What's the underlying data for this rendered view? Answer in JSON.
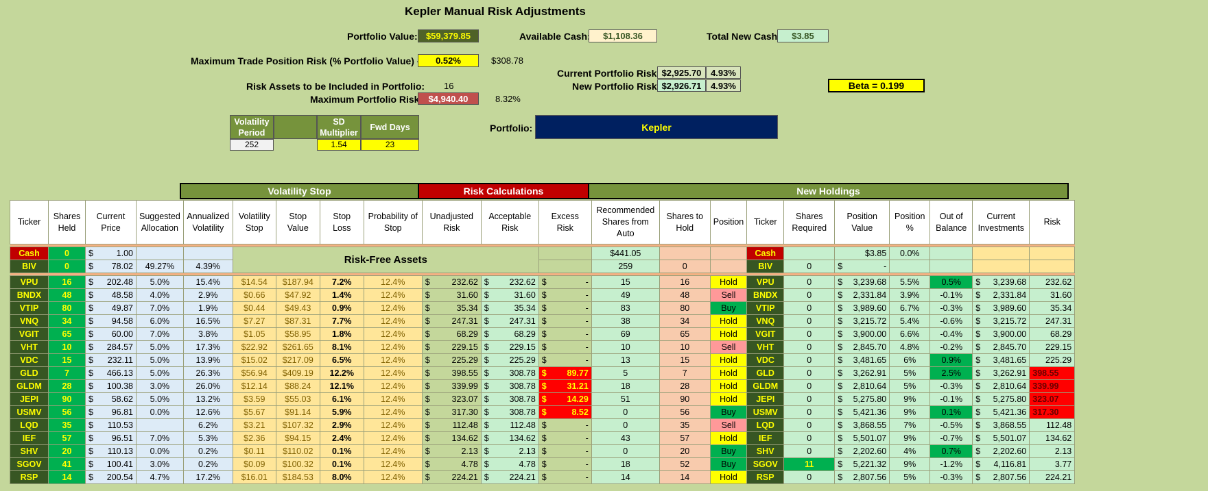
{
  "title": "Kepler Manual Risk Adjustments",
  "summary": {
    "portfolio_value_label": "Portfolio Value:",
    "portfolio_value": "$59,379.85",
    "available_cash_label": "Available Cash:",
    "available_cash": "$1,108.36",
    "total_new_cash_label": "Total New Cash:",
    "total_new_cash": "$3.85",
    "max_trade_risk_label": "Maximum Trade Position Risk (% Portfolio Value) - R:",
    "max_trade_risk_pct": "0.52%",
    "max_trade_risk_value": "$308.78",
    "current_portfolio_risk_label": "Current Portfolio Risk:",
    "current_portfolio_risk": "$2,925.70",
    "current_portfolio_risk_pct": "4.93%",
    "new_portfolio_risk_label": "New Portfolio Risk:",
    "new_portfolio_risk": "$2,926.71",
    "new_portfolio_risk_pct": "4.93%",
    "risk_assets_label": "Risk Assets to be Included in Portfolio:",
    "risk_assets": "16",
    "max_portfolio_risk_label": "Maximum Portfolio Risk:",
    "max_portfolio_risk": "$4,940.40",
    "max_portfolio_risk_pct": "8.32%",
    "beta": "Beta =  0.199",
    "portfolio_label": "Portfolio:",
    "portfolio_name": "Kepler"
  },
  "params": {
    "vol_period_label": "Volatility Period",
    "vol_period": "252",
    "sd_mult_label": "SD Multiplier",
    "sd_mult": "1.54",
    "fwd_days_label": "Fwd Days",
    "fwd_days": "23"
  },
  "bands": {
    "volatility_stop": "Volatility Stop",
    "risk_calculations": "Risk Calculations",
    "new_holdings": "New Holdings",
    "risk_free_assets": "Risk-Free Assets"
  },
  "columns": [
    "Ticker",
    "Shares Held",
    "Current Price",
    "Suggested Allocation",
    "Annualized Volatility",
    "Volatility Stop",
    "Stop Value",
    "Stop Loss",
    "Probability of Stop",
    "Unadjusted Risk",
    "Acceptable Risk",
    "Excess Risk",
    "Recommended Shares from Auto",
    "Shares to Hold",
    "Position",
    "Ticker",
    "Shares Required",
    "Position Value",
    "Position %",
    "Out of Balance",
    "Current Investments",
    "Risk"
  ],
  "cash_row": {
    "ticker": "Cash",
    "held": "0",
    "price": "1.00",
    "rec": "$441.05",
    "ticker2": "Cash",
    "posval": "$3.85",
    "pospct": "0.0%"
  },
  "biv_row": {
    "ticker": "BIV",
    "held": "0",
    "price": "78.02",
    "alloc": "49.27%",
    "vol": "4.39%",
    "rec": "259",
    "hold": "0",
    "ticker2": "BIV",
    "req": "0",
    "posval": "-"
  },
  "rows": [
    {
      "t": "VPU",
      "h": "16",
      "p": "202.48",
      "a": "5.0%",
      "v": "15.4%",
      "vs": "$14.54",
      "sv": "$187.94",
      "sl": "7.2%",
      "ps": "12.4%",
      "ur": "232.62",
      "ar": "232.62",
      "er": "-",
      "rec": "15",
      "hold": "16",
      "pos": "Hold",
      "req": "0",
      "pv": "3,239.68",
      "pp": "5.5%",
      "oob": "0.5%",
      "ci": "3,239.68",
      "risk": "232.62"
    },
    {
      "t": "BNDX",
      "h": "48",
      "p": "48.58",
      "a": "4.0%",
      "v": "2.9%",
      "vs": "$0.66",
      "sv": "$47.92",
      "sl": "1.4%",
      "ps": "12.4%",
      "ur": "31.60",
      "ar": "31.60",
      "er": "-",
      "rec": "49",
      "hold": "48",
      "pos": "Sell",
      "req": "0",
      "pv": "2,331.84",
      "pp": "3.9%",
      "oob": "-0.1%",
      "ci": "2,331.84",
      "risk": "31.60"
    },
    {
      "t": "VTIP",
      "h": "80",
      "p": "49.87",
      "a": "7.0%",
      "v": "1.9%",
      "vs": "$0.44",
      "sv": "$49.43",
      "sl": "0.9%",
      "ps": "12.4%",
      "ur": "35.34",
      "ar": "35.34",
      "er": "-",
      "rec": "83",
      "hold": "80",
      "pos": "Buy",
      "req": "0",
      "pv": "3,989.60",
      "pp": "6.7%",
      "oob": "-0.3%",
      "ci": "3,989.60",
      "risk": "35.34"
    },
    {
      "t": "VNQ",
      "h": "34",
      "p": "94.58",
      "a": "6.0%",
      "v": "16.5%",
      "vs": "$7.27",
      "sv": "$87.31",
      "sl": "7.7%",
      "ps": "12.4%",
      "ur": "247.31",
      "ar": "247.31",
      "er": "-",
      "rec": "38",
      "hold": "34",
      "pos": "Hold",
      "req": "0",
      "pv": "3,215.72",
      "pp": "5.4%",
      "oob": "-0.6%",
      "ci": "3,215.72",
      "risk": "247.31"
    },
    {
      "t": "VGIT",
      "h": "65",
      "p": "60.00",
      "a": "7.0%",
      "v": "3.8%",
      "vs": "$1.05",
      "sv": "$58.95",
      "sl": "1.8%",
      "ps": "12.4%",
      "ur": "68.29",
      "ar": "68.29",
      "er": "-",
      "rec": "69",
      "hold": "65",
      "pos": "Hold",
      "req": "0",
      "pv": "3,900.00",
      "pp": "6.6%",
      "oob": "-0.4%",
      "ci": "3,900.00",
      "risk": "68.29"
    },
    {
      "t": "VHT",
      "h": "10",
      "p": "284.57",
      "a": "5.0%",
      "v": "17.3%",
      "vs": "$22.92",
      "sv": "$261.65",
      "sl": "8.1%",
      "ps": "12.4%",
      "ur": "229.15",
      "ar": "229.15",
      "er": "-",
      "rec": "10",
      "hold": "10",
      "pos": "Sell",
      "req": "0",
      "pv": "2,845.70",
      "pp": "4.8%",
      "oob": "-0.2%",
      "ci": "2,845.70",
      "risk": "229.15"
    },
    {
      "t": "VDC",
      "h": "15",
      "p": "232.11",
      "a": "5.0%",
      "v": "13.9%",
      "vs": "$15.02",
      "sv": "$217.09",
      "sl": "6.5%",
      "ps": "12.4%",
      "ur": "225.29",
      "ar": "225.29",
      "er": "-",
      "rec": "13",
      "hold": "15",
      "pos": "Hold",
      "req": "0",
      "pv": "3,481.65",
      "pp": "6%",
      "oob": "0.9%",
      "ci": "3,481.65",
      "risk": "225.29"
    },
    {
      "t": "GLD",
      "h": "7",
      "p": "466.13",
      "a": "5.0%",
      "v": "26.3%",
      "vs": "$56.94",
      "sv": "$409.19",
      "sl": "12.2%",
      "ps": "12.4%",
      "ur": "398.55",
      "ar": "308.78",
      "er": "89.77",
      "rec": "5",
      "hold": "7",
      "pos": "Hold",
      "req": "0",
      "pv": "3,262.91",
      "pp": "5%",
      "oob": "2.5%",
      "ci": "3,262.91",
      "risk": "398.55"
    },
    {
      "t": "GLDM",
      "h": "28",
      "p": "100.38",
      "a": "3.0%",
      "v": "26.0%",
      "vs": "$12.14",
      "sv": "$88.24",
      "sl": "12.1%",
      "ps": "12.4%",
      "ur": "339.99",
      "ar": "308.78",
      "er": "31.21",
      "rec": "18",
      "hold": "28",
      "pos": "Hold",
      "req": "0",
      "pv": "2,810.64",
      "pp": "5%",
      "oob": "-0.3%",
      "ci": "2,810.64",
      "risk": "339.99"
    },
    {
      "t": "JEPI",
      "h": "90",
      "p": "58.62",
      "a": "5.0%",
      "v": "13.2%",
      "vs": "$3.59",
      "sv": "$55.03",
      "sl": "6.1%",
      "ps": "12.4%",
      "ur": "323.07",
      "ar": "308.78",
      "er": "14.29",
      "rec": "51",
      "hold": "90",
      "pos": "Hold",
      "req": "0",
      "pv": "5,275.80",
      "pp": "9%",
      "oob": "-0.1%",
      "ci": "5,275.80",
      "risk": "323.07"
    },
    {
      "t": "USMV",
      "h": "56",
      "p": "96.81",
      "a": "0.0%",
      "v": "12.6%",
      "vs": "$5.67",
      "sv": "$91.14",
      "sl": "5.9%",
      "ps": "12.4%",
      "ur": "317.30",
      "ar": "308.78",
      "er": "8.52",
      "rec": "0",
      "hold": "56",
      "pos": "Buy",
      "req": "0",
      "pv": "5,421.36",
      "pp": "9%",
      "oob": "0.1%",
      "ci": "5,421.36",
      "risk": "317.30"
    },
    {
      "t": "LQD",
      "h": "35",
      "p": "110.53",
      "a": "",
      "v": "6.2%",
      "vs": "$3.21",
      "sv": "$107.32",
      "sl": "2.9%",
      "ps": "12.4%",
      "ur": "112.48",
      "ar": "112.48",
      "er": "-",
      "rec": "0",
      "hold": "35",
      "pos": "Sell",
      "req": "0",
      "pv": "3,868.55",
      "pp": "7%",
      "oob": "-0.5%",
      "ci": "3,868.55",
      "risk": "112.48"
    },
    {
      "t": "IEF",
      "h": "57",
      "p": "96.51",
      "a": "7.0%",
      "v": "5.3%",
      "vs": "$2.36",
      "sv": "$94.15",
      "sl": "2.4%",
      "ps": "12.4%",
      "ur": "134.62",
      "ar": "134.62",
      "er": "-",
      "rec": "43",
      "hold": "57",
      "pos": "Hold",
      "req": "0",
      "pv": "5,501.07",
      "pp": "9%",
      "oob": "-0.7%",
      "ci": "5,501.07",
      "risk": "134.62"
    },
    {
      "t": "SHV",
      "h": "20",
      "p": "110.13",
      "a": "0.0%",
      "v": "0.2%",
      "vs": "$0.11",
      "sv": "$110.02",
      "sl": "0.1%",
      "ps": "12.4%",
      "ur": "2.13",
      "ar": "2.13",
      "er": "-",
      "rec": "0",
      "hold": "20",
      "pos": "Buy",
      "req": "0",
      "pv": "2,202.60",
      "pp": "4%",
      "oob": "0.7%",
      "ci": "2,202.60",
      "risk": "2.13"
    },
    {
      "t": "SGOV",
      "h": "41",
      "p": "100.41",
      "a": "3.0%",
      "v": "0.2%",
      "vs": "$0.09",
      "sv": "$100.32",
      "sl": "0.1%",
      "ps": "12.4%",
      "ur": "4.78",
      "ar": "4.78",
      "er": "-",
      "rec": "18",
      "hold": "52",
      "pos": "Buy",
      "req": "11",
      "pv": "5,221.32",
      "pp": "9%",
      "oob": "-1.2%",
      "ci": "4,116.81",
      "risk": "3.77"
    },
    {
      "t": "RSP",
      "h": "14",
      "p": "200.54",
      "a": "4.7%",
      "v": "17.2%",
      "vs": "$16.01",
      "sv": "$184.53",
      "sl": "8.0%",
      "ps": "12.4%",
      "ur": "224.21",
      "ar": "224.21",
      "er": "-",
      "rec": "14",
      "hold": "14",
      "pos": "Hold",
      "req": "0",
      "pv": "2,807.56",
      "pp": "5%",
      "oob": "-0.3%",
      "ci": "2,807.56",
      "risk": "224.21"
    }
  ],
  "colors": {
    "background": "#c4d79b",
    "header_band": "#76933c",
    "risk_band": "#c00000",
    "portfolio_box": "#002060"
  }
}
